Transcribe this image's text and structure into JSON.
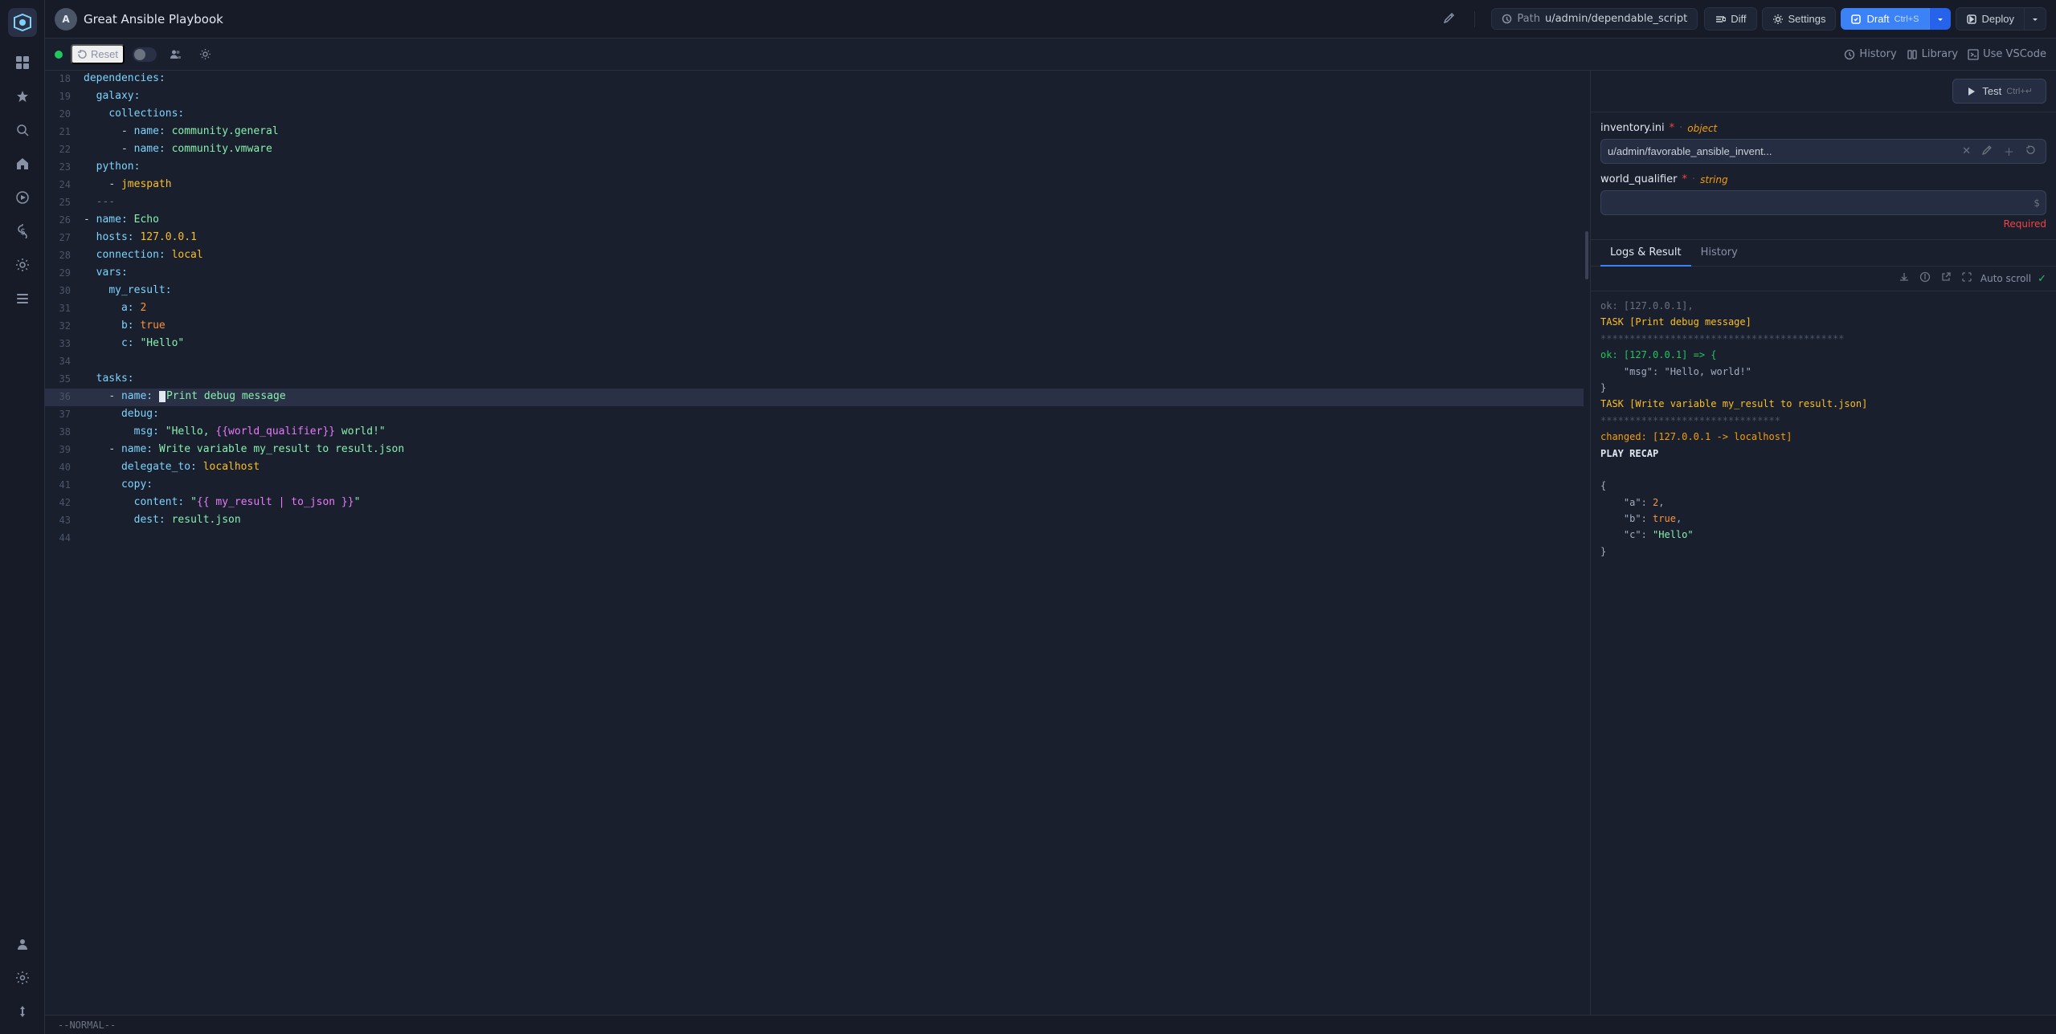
{
  "app": {
    "title": "Great Ansible Playbook",
    "path_label": "Path",
    "path_value": "u/admin/dependable_script"
  },
  "topbar": {
    "avatar": "A",
    "title": "Great Ansible Playbook",
    "diff_label": "Diff",
    "settings_label": "Settings",
    "draft_label": "Draft",
    "draft_shortcut": "Ctrl+S",
    "deploy_label": "Deploy"
  },
  "toolbar": {
    "reset_label": "Reset",
    "history_label": "History",
    "library_label": "Library",
    "vscode_label": "Use VSCode"
  },
  "code": {
    "lines": [
      {
        "num": 18,
        "content": "dependencies:",
        "type": "key"
      },
      {
        "num": 19,
        "content": "  galaxy:",
        "type": "key-indent"
      },
      {
        "num": 20,
        "content": "    collections:",
        "type": "key-indent2"
      },
      {
        "num": 21,
        "content": "      - name: community.general",
        "type": "dash-key-str"
      },
      {
        "num": 22,
        "content": "      - name: community.vmware",
        "type": "dash-key-str"
      },
      {
        "num": 23,
        "content": "  python:",
        "type": "key-indent"
      },
      {
        "num": 24,
        "content": "    - jmespath",
        "type": "dash-val"
      },
      {
        "num": 25,
        "content": "  ---",
        "type": "comment"
      },
      {
        "num": 26,
        "content": "- name: Echo",
        "type": "dash-key-str"
      },
      {
        "num": 27,
        "content": "  hosts: 127.0.0.1",
        "type": "key-val"
      },
      {
        "num": 28,
        "content": "  connection: local",
        "type": "key-val"
      },
      {
        "num": 29,
        "content": "  vars:",
        "type": "key"
      },
      {
        "num": 30,
        "content": "    my_result:",
        "type": "key-indent"
      },
      {
        "num": 31,
        "content": "      a: 2",
        "type": "key-num"
      },
      {
        "num": 32,
        "content": "      b: true",
        "type": "key-bool"
      },
      {
        "num": 33,
        "content": "      c: \"Hello\"",
        "type": "key-str"
      },
      {
        "num": 34,
        "content": "",
        "type": "empty"
      },
      {
        "num": 35,
        "content": "  tasks:",
        "type": "key"
      },
      {
        "num": 36,
        "content": "    - name: Print debug message",
        "type": "highlighted",
        "cursor": true
      },
      {
        "num": 37,
        "content": "      debug:",
        "type": "key-indent2"
      },
      {
        "num": 38,
        "content": "        msg: \"Hello, {{world_qualifier}} world!\"",
        "type": "key-tpl-str"
      },
      {
        "num": 39,
        "content": "    - name: Write variable my_result to result.json",
        "type": "dash-key-str"
      },
      {
        "num": 40,
        "content": "      delegate_to: localhost",
        "type": "key-val"
      },
      {
        "num": 41,
        "content": "      copy:",
        "type": "key-indent2"
      },
      {
        "num": 42,
        "content": "        content: \"{{ my_result | to_json }}\"",
        "type": "key-tpl-str"
      },
      {
        "num": 43,
        "content": "        dest: result.json",
        "type": "key-str"
      },
      {
        "num": 44,
        "content": "",
        "type": "empty"
      }
    ]
  },
  "right_panel": {
    "test_label": "Test",
    "test_shortcut": "Ctrl+↵",
    "inventory_label": "inventory.ini",
    "inventory_required": "*",
    "inventory_type": "object",
    "inventory_value": "u/admin/favorable_ansible_invent...",
    "world_qualifier_label": "world_qualifier",
    "world_qualifier_required": "*",
    "world_qualifier_type": "string",
    "world_qualifier_placeholder": "",
    "required_msg": "Required",
    "dollar_sign": "$"
  },
  "logs": {
    "tab_logs": "Logs & Result",
    "tab_history": "History",
    "auto_scroll": "Auto scroll",
    "top_partial": "ok: [127.0.0.1],",
    "content": [
      {
        "type": "task",
        "text": "TASK [Print debug message]"
      },
      {
        "type": "stars",
        "text": "******************************************"
      },
      {
        "type": "ok",
        "text": "ok: [127.0.0.1] => {"
      },
      {
        "type": "normal",
        "text": "    \"msg\": \"Hello,  world!\""
      },
      {
        "type": "normal",
        "text": "}"
      },
      {
        "type": "task",
        "text": "TASK [Write variable my_result to result.json]"
      },
      {
        "type": "stars",
        "text": "*******************************"
      },
      {
        "type": "changed",
        "text": "changed: [127.0.0.1 -> localhost]"
      },
      {
        "type": "recap",
        "text": "PLAY RECAP"
      },
      {
        "type": "empty",
        "text": ""
      },
      {
        "type": "normal",
        "text": "{"
      },
      {
        "type": "normal",
        "text": "    \"a\": 2,"
      },
      {
        "type": "normal",
        "text": "    \"b\": true,"
      },
      {
        "type": "normal",
        "text": "    \"c\": \"Hello\""
      },
      {
        "type": "normal",
        "text": "}"
      }
    ]
  },
  "status_bar": {
    "mode": "--NORMAL--"
  },
  "sidebar": {
    "items": [
      {
        "icon": "⊞",
        "name": "grid-icon"
      },
      {
        "icon": "★",
        "name": "star-icon"
      },
      {
        "icon": "○",
        "name": "circle-icon"
      },
      {
        "icon": "⌂",
        "name": "home-icon"
      },
      {
        "icon": "▷",
        "name": "play-icon"
      },
      {
        "icon": "$",
        "name": "dollar-icon"
      },
      {
        "icon": "⚙",
        "name": "cog-icon"
      },
      {
        "icon": "☰",
        "name": "menu-icon"
      },
      {
        "icon": "👤",
        "name": "user-icon"
      },
      {
        "icon": "⚙",
        "name": "settings-icon"
      },
      {
        "icon": "↕",
        "name": "arrows-icon"
      }
    ]
  }
}
